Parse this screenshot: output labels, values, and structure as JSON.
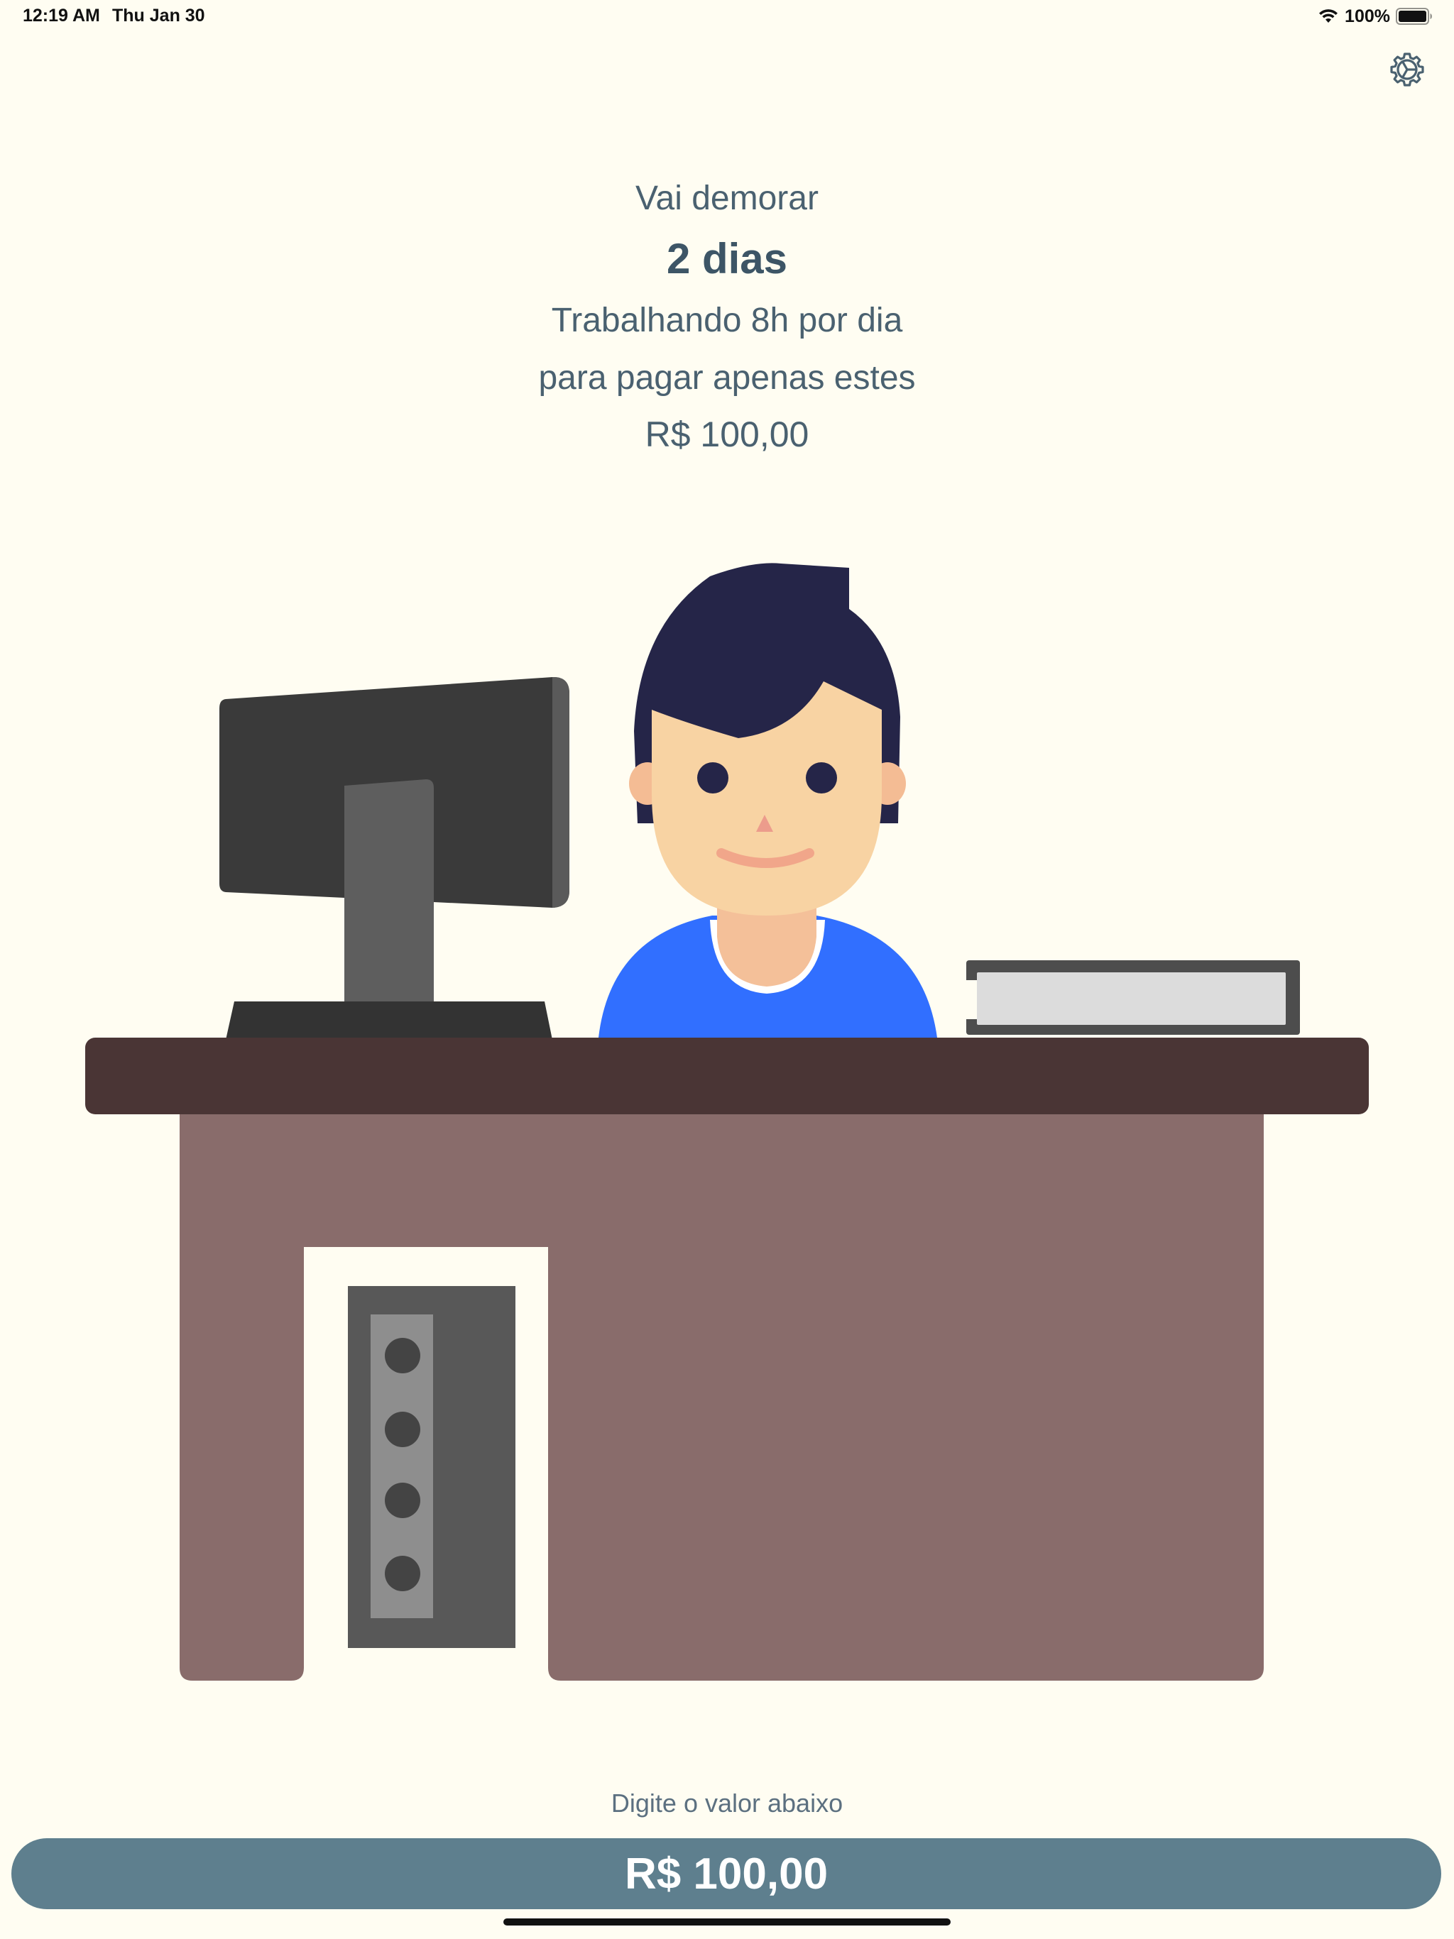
{
  "status_bar": {
    "time": "12:19 AM",
    "date": "Thu Jan 30",
    "battery_percent": "100%",
    "battery_level": 1.0,
    "icons": [
      "wifi-icon",
      "battery-icon"
    ]
  },
  "header": {
    "settings_icon": "gear-icon"
  },
  "result": {
    "intro": "Vai demorar",
    "duration": "2 dias",
    "work_hours": "Trabalhando 8h por dia",
    "purpose": "para pagar apenas estes",
    "amount": "R$ 100,00"
  },
  "illustration": {
    "name": "worker-at-desk-illustration",
    "colors": {
      "hair": "#252548",
      "skin": "#F8D3A3",
      "shirt": "#316FFF",
      "desk_top": "#4A3535",
      "desk_body": "#896C6B",
      "monitor": "#3A3A3A",
      "pc_tower": "#585858"
    }
  },
  "input": {
    "label": "Digite o valor abaixo",
    "value": "R$ 100,00"
  },
  "colors": {
    "background": "#FFFDF2",
    "text": "#4A6170",
    "input_background": "#5E7F8E",
    "input_text": "#FFFFFF"
  }
}
